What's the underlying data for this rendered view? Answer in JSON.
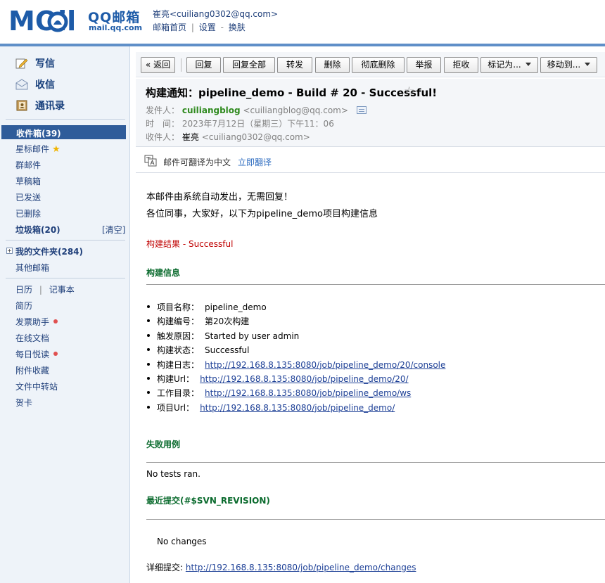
{
  "brand": {
    "logo_text": "MOil",
    "cn": "QQ邮箱",
    "url": "mail.qq.com"
  },
  "header": {
    "user": "崔亮<cuiliang0302@qq.com>",
    "links": [
      "邮箱首页",
      "设置",
      "换肤"
    ],
    "sep": "|",
    "dash": "-"
  },
  "sidebar": {
    "write": "写信",
    "receive": "收信",
    "contacts": "通讯录",
    "inbox": "收件箱(39)",
    "items": [
      "星标邮件",
      "群邮件",
      "草稿箱",
      "已发送",
      "已删除"
    ],
    "junk": "垃圾箱(20)",
    "junk_clear": "[清空]",
    "my_folders": "我的文件夹(284)",
    "other_mail": "其他邮箱",
    "calendar": "日历",
    "calendar_sep": "|",
    "notes": "记事本",
    "tools": [
      "简历",
      "发票助手",
      "在线文档",
      "每日悦读",
      "附件收藏",
      "文件中转站",
      "贺卡"
    ]
  },
  "toolbar": {
    "back": "« 返回",
    "reply": "回复",
    "reply_all": "回复全部",
    "forward": "转发",
    "delete": "删除",
    "delete_forever": "彻底删除",
    "report": "举报",
    "reject": "拒收",
    "mark_as": "标记为...",
    "move_to": "移动到..."
  },
  "mail": {
    "subject": "构建通知：pipeline_demo - Build # 20 - Successful!",
    "from_label": "发件人：",
    "from_name": "cuiliangblog",
    "from_email": "<cuiliangblog@qq.com>",
    "time_label": "时　间：",
    "time": "2023年7月12日（星期三）下午11：06",
    "to_label": "收件人：",
    "to_name": "崔亮",
    "to_email": "<cuiliang0302@qq.com>"
  },
  "translate": {
    "text": "邮件可翻译为中文",
    "link": "立即翻译"
  },
  "body": {
    "intro1": "本邮件由系统自动发出，无需回复！",
    "intro2": "各位同事，大家好，以下为pipeline_demo项目构建信息",
    "result": "构建结果 - Successful",
    "build_info_title": "构建信息",
    "info": [
      {
        "label": "项目名称：",
        "value": "pipeline_demo"
      },
      {
        "label": "构建编号：",
        "value": "第20次构建"
      },
      {
        "label": "触发原因：",
        "value": "Started by user admin"
      },
      {
        "label": "构建状态：",
        "value": "Successful"
      },
      {
        "label": "构建日志：",
        "value": "http://192.168.8.135:8080/job/pipeline_demo/20/console"
      },
      {
        "label": "构建Url：",
        "value": "http://192.168.8.135:8080/job/pipeline_demo/20/"
      },
      {
        "label": "工作目录：",
        "value": "http://192.168.8.135:8080/job/pipeline_demo/ws"
      },
      {
        "label": "项目Url：",
        "value": "http://192.168.8.135:8080/job/pipeline_demo/"
      }
    ],
    "failed_title": "失败用例",
    "no_tests": "No tests ran.",
    "recent_title": "最近提交(#$SVN_REVISION)",
    "no_changes": "No changes",
    "detail_label": "详细提交: ",
    "detail_link": "http://192.168.8.135:8080/job/pipeline_demo/changes"
  },
  "colors": {
    "accent": "#2f5c9a",
    "sender": "#2f8a1e",
    "result": "#c00000",
    "section": "#0b6b2e",
    "link": "#1c3f96"
  },
  "icons": {
    "write": "compose-icon",
    "receive": "inbox-icon",
    "contacts": "contacts-icon",
    "translate": "translate-icon",
    "star": "star-icon"
  }
}
